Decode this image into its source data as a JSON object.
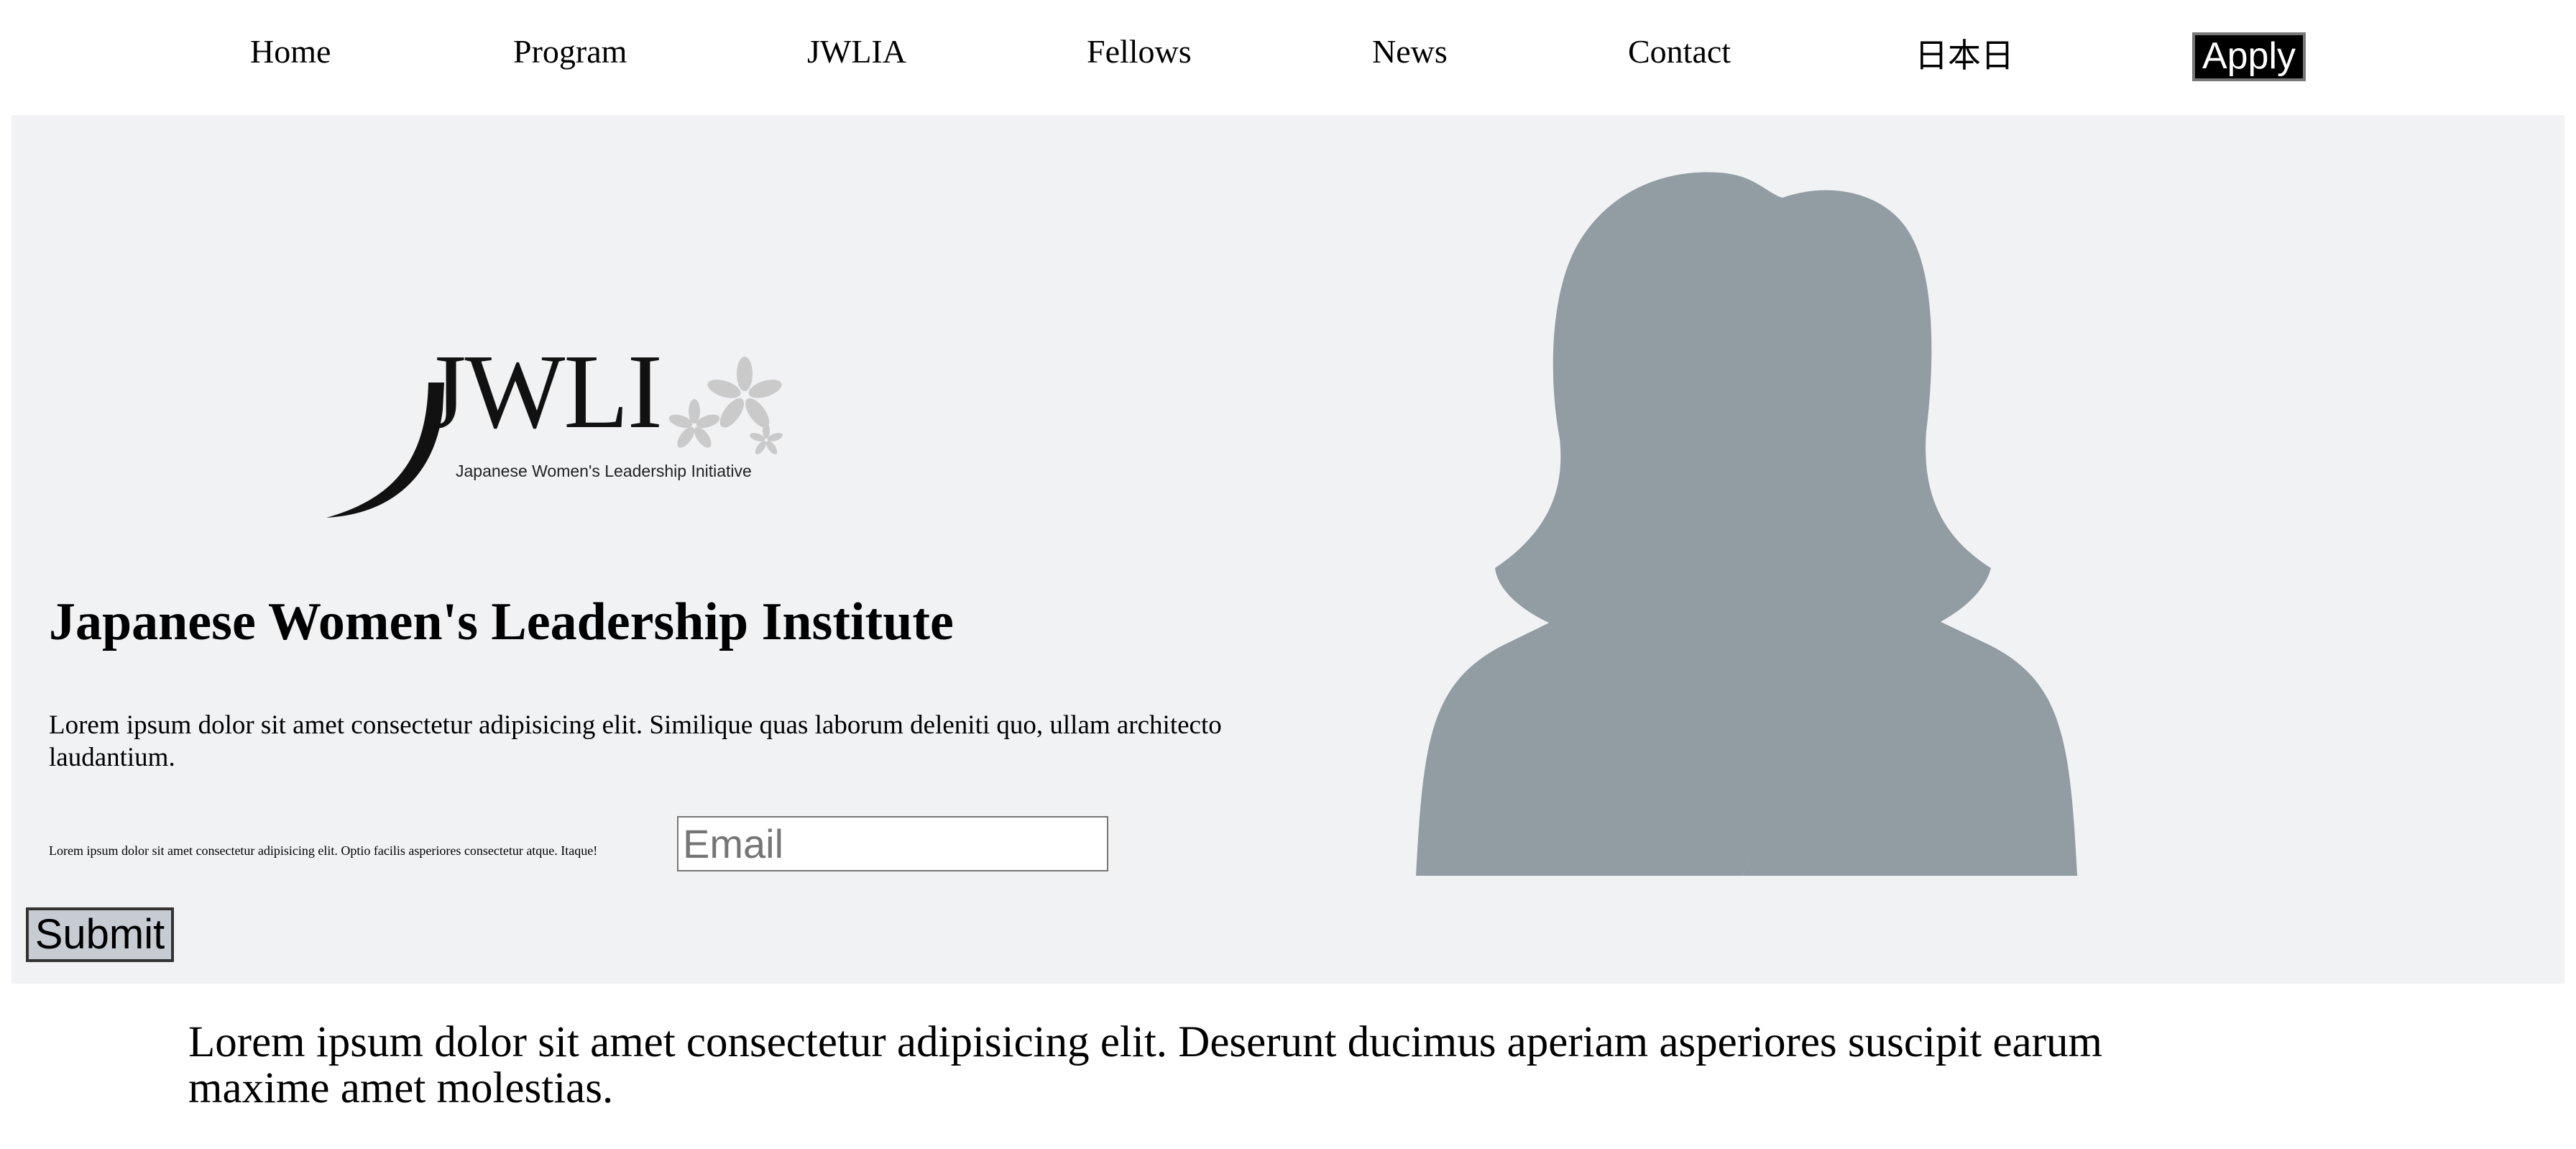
{
  "nav": {
    "items": [
      {
        "label": "Home"
      },
      {
        "label": "Program"
      },
      {
        "label": "JWLIA"
      },
      {
        "label": "Fellows"
      },
      {
        "label": "News"
      },
      {
        "label": "Contact"
      },
      {
        "label": "日本日"
      }
    ],
    "apply_label": "Apply"
  },
  "hero": {
    "logo": {
      "text": "JWLI",
      "tagline": "Japanese Women's Leadership Initiative"
    },
    "title": "Japanese Women's Leadership Institute",
    "description": "Lorem ipsum dolor sit amet consectetur adipisicing elit. Similique quas laborum deleniti quo, ullam architecto laudantium.",
    "small_text": "Lorem ipsum dolor sit amet consectetur adipisicing elit. Optio facilis asperiores consectetur atque. Itaque!",
    "email_placeholder": "Email",
    "submit_label": "Submit"
  },
  "body_text": "Lorem ipsum dolor sit amet consectetur adipisicing elit. Deserunt ducimus aperiam asperiores suscipit earum maxime amet molestias.",
  "colors": {
    "hero_bg": "#f1f2f4",
    "avatar": "#929da3",
    "apply_bg": "#000000",
    "submit_bg": "#c7ccd3"
  }
}
